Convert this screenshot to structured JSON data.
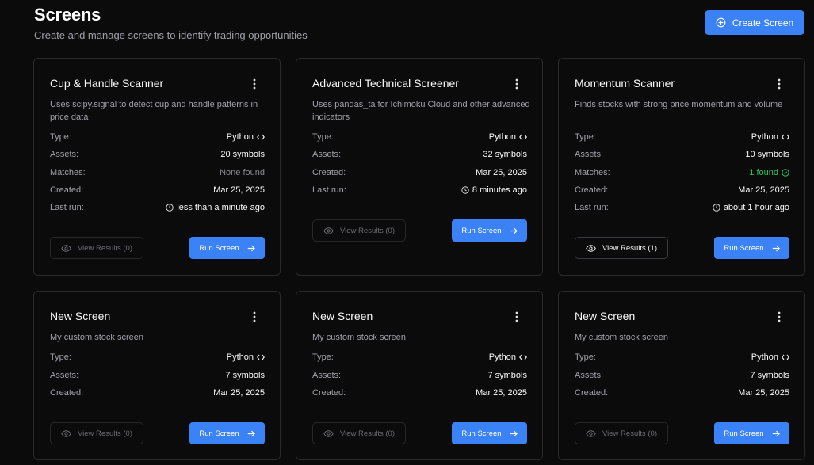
{
  "header": {
    "title": "Screens",
    "subtitle": "Create and manage screens to identify trading opportunities",
    "create_button": "Create Screen"
  },
  "labels": {
    "type": "Type:",
    "assets": "Assets:",
    "matches": "Matches:",
    "created": "Created:",
    "last_run": "Last run:",
    "run_button": "Run Screen"
  },
  "colors": {
    "accent": "#3b82f6",
    "success": "#22c55e",
    "background": "#0b0b0c"
  },
  "cards": [
    {
      "title": "Cup & Handle Scanner",
      "description": "Uses scipy.signal to detect cup and handle patterns in price data",
      "type": "Python",
      "assets": "20 symbols",
      "matches": "None found",
      "created": "Mar 25, 2025",
      "last_run": "less than a minute ago",
      "view_results": "View Results (0)"
    },
    {
      "title": "Advanced Technical Screener",
      "description": "Uses pandas_ta for Ichimoku Cloud and other advanced indicators",
      "type": "Python",
      "assets": "32 symbols",
      "created": "Mar 25, 2025",
      "last_run": "8 minutes ago",
      "view_results": "View Results (0)"
    },
    {
      "title": "Momentum Scanner",
      "description": "Finds stocks with strong price momentum and volume",
      "type": "Python",
      "assets": "10 symbols",
      "matches": "1 found",
      "created": "Mar 25, 2025",
      "last_run": "about 1 hour ago",
      "view_results": "View Results (1)"
    },
    {
      "title": "New Screen",
      "description": "My custom stock screen",
      "type": "Python",
      "assets": "7 symbols",
      "created": "Mar 25, 2025",
      "view_results": "View Results (0)"
    },
    {
      "title": "New Screen",
      "description": "My custom stock screen",
      "type": "Python",
      "assets": "7 symbols",
      "created": "Mar 25, 2025",
      "view_results": "View Results (0)"
    },
    {
      "title": "New Screen",
      "description": "My custom stock screen",
      "type": "Python",
      "assets": "7 symbols",
      "created": "Mar 25, 2025",
      "view_results": "View Results (0)"
    }
  ]
}
